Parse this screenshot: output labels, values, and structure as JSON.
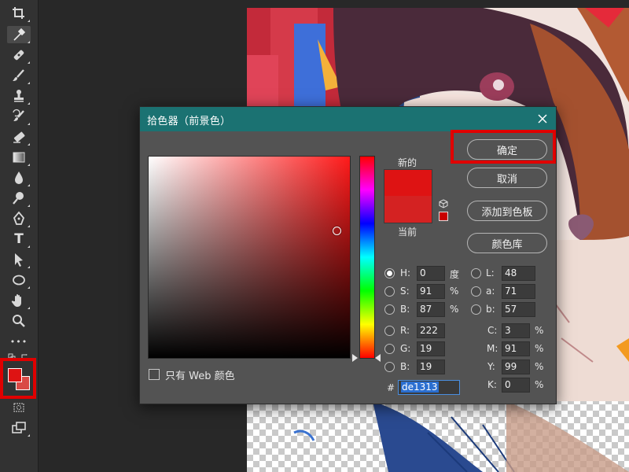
{
  "colors": {
    "accent_title_bar": "#1b7272",
    "highlight": "#e00000",
    "foreground": "#de1313"
  },
  "toolbar": {
    "tools": [
      {
        "name": "crop-tool-icon"
      },
      {
        "name": "eyedropper-tool-icon"
      },
      {
        "name": "healing-brush-tool-icon"
      },
      {
        "name": "brush-tool-icon"
      },
      {
        "name": "clone-stamp-tool-icon"
      },
      {
        "name": "history-brush-tool-icon"
      },
      {
        "name": "eraser-tool-icon"
      },
      {
        "name": "gradient-tool-icon"
      },
      {
        "name": "blur-tool-icon"
      },
      {
        "name": "dodge-tool-icon"
      },
      {
        "name": "pen-tool-icon"
      },
      {
        "name": "type-tool-icon"
      },
      {
        "name": "path-selection-tool-icon"
      },
      {
        "name": "ellipse-tool-icon"
      },
      {
        "name": "hand-tool-icon"
      },
      {
        "name": "zoom-tool-icon"
      },
      {
        "name": "more-tools-icon"
      }
    ],
    "type_glyph": "T",
    "more_glyph": "•••"
  },
  "dialog": {
    "title": "拾色器（前景色）",
    "buttons": {
      "ok": "确定",
      "cancel": "取消",
      "add_swatch": "添加到色板",
      "color_library": "颜色库"
    },
    "new_label": "新的",
    "current_label": "当前",
    "new_color": "#de1313",
    "current_color": "#d42222",
    "web_only_label": "只有 Web 颜色",
    "fields": {
      "H": {
        "label": "H:",
        "value": "0",
        "unit": "度"
      },
      "S": {
        "label": "S:",
        "value": "91",
        "unit": "%"
      },
      "Bv": {
        "label": "B:",
        "value": "87",
        "unit": "%"
      },
      "R": {
        "label": "R:",
        "value": "222"
      },
      "G": {
        "label": "G:",
        "value": "19"
      },
      "Bc": {
        "label": "B:",
        "value": "19"
      },
      "L": {
        "label": "L:",
        "value": "48"
      },
      "a": {
        "label": "a:",
        "value": "71"
      },
      "b": {
        "label": "b:",
        "value": "57"
      },
      "C": {
        "label": "C:",
        "value": "3",
        "unit": "%"
      },
      "M": {
        "label": "M:",
        "value": "91",
        "unit": "%"
      },
      "Y": {
        "label": "Y:",
        "value": "99",
        "unit": "%"
      },
      "K": {
        "label": "K:",
        "value": "0",
        "unit": "%"
      }
    },
    "hex_label": "#",
    "hex_value": "de1313"
  }
}
